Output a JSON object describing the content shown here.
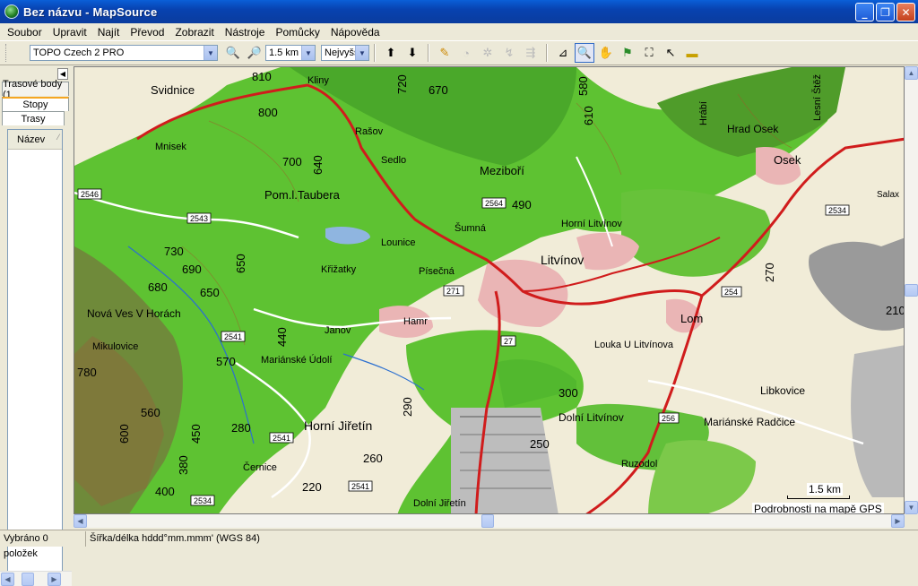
{
  "window": {
    "title": "Bez názvu - MapSource",
    "minimize": "_",
    "maximize": "❐",
    "close": "✕"
  },
  "menu": [
    "Soubor",
    "Upravit",
    "Najít",
    "Převod",
    "Zobrazit",
    "Nástroje",
    "Pomůcky",
    "Nápověda"
  ],
  "toolbar": {
    "map_product": "TOPO Czech 2 PRO",
    "zoom_level": "1.5 km",
    "detail_level": "Nejvyšší"
  },
  "sidebar": {
    "tabs": [
      "Trasové body (1",
      "Stopy",
      "Trasy"
    ],
    "active_tab": "Trasy",
    "column_header": "Název"
  },
  "map": {
    "scale_label": "1.5 km",
    "gps_detail_label": "Podrobnosti na mapě GPS",
    "places": [
      "Svidnice",
      "Kliny",
      "Rašov",
      "Sedlo",
      "Mnisek",
      "Pom.l.Taubera",
      "Meziboří",
      "Horní Litvínov",
      "Litvínov",
      "Lounice",
      "Šumná",
      "Křižatky",
      "Písečná",
      "Hamr",
      "Janov",
      "Nová Ves V Horách",
      "Mikulovice",
      "Mariánské Údolí",
      "Horní Jiřetín",
      "Černice",
      "Dolní Jiřetín",
      "Louka U Litvínova",
      "Lom",
      "Dolní Litvínov",
      "Mariánské Radčice",
      "Libkovice",
      "Ruzodol",
      "Hrad Osek",
      "Osek",
      "Lesní Štěž",
      "Hrábí",
      "Salax"
    ],
    "elevations": [
      "810",
      "720",
      "670",
      "800",
      "700",
      "640",
      "610",
      "650",
      "730",
      "690",
      "680",
      "650",
      "440",
      "570",
      "560",
      "600",
      "450",
      "400",
      "380",
      "220",
      "290",
      "300",
      "250",
      "260",
      "280",
      "270",
      "490",
      "580",
      "780",
      "210"
    ],
    "road_numbers": [
      "2543",
      "2541",
      "2534",
      "2546",
      "2541",
      "2564",
      "271",
      "27",
      "254",
      "256",
      "2541",
      "2534"
    ]
  },
  "status": {
    "selection": "Vybráno 0 položek",
    "coordinates": "Šířka/délka hddd°mm.mmm' (WGS 84)"
  }
}
